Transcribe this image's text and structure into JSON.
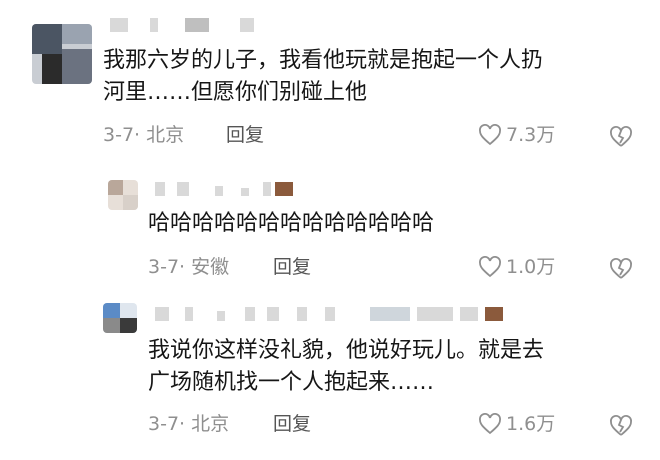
{
  "comments": [
    {
      "text": "我那六岁的儿子，我看他玩就是抱起一个人扔\n河里……但愿你们别碰上他",
      "date": "3-7",
      "location": "北京",
      "reply_label": "回复",
      "likes": "7.3万"
    },
    {
      "text": "哈哈哈哈哈哈哈哈哈哈哈哈哈",
      "date": "3-7",
      "location": "安徽",
      "reply_label": "回复",
      "likes": "1.0万"
    },
    {
      "text": "我说你这样没礼貌，他说好玩儿。就是去\n广场随机找一个人抱起来……",
      "date": "3-7",
      "location": "北京",
      "reply_label": "回复",
      "likes": "1.6万"
    }
  ],
  "colors": {
    "text": "#161616",
    "meta": "#8f8f8f",
    "reply": "#555555",
    "censor": "#d9d9d9"
  },
  "icons": {
    "like": "heart-outline-icon",
    "dislike": "broken-heart-icon"
  }
}
